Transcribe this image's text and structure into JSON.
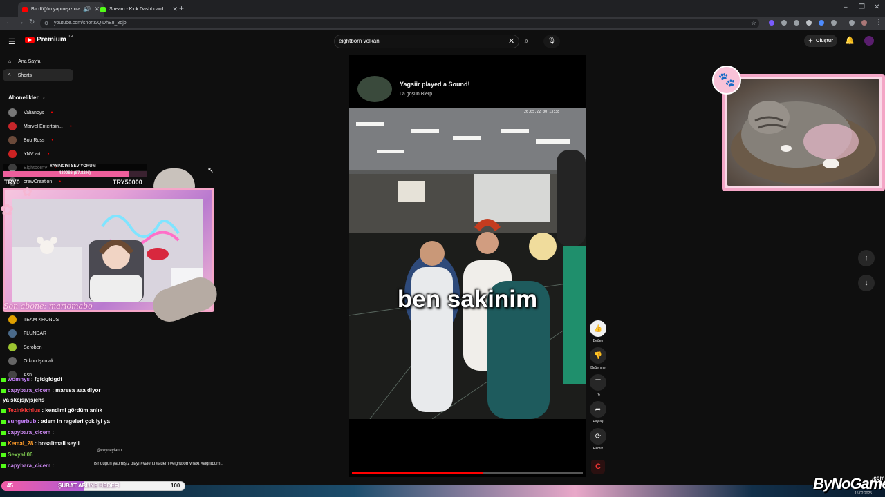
{
  "browser": {
    "tabs": [
      {
        "title": "Bir düğün yapmışız olayı #..."
      },
      {
        "title": "Stream - Kick Dashboard"
      }
    ],
    "url": "youtube.com/shorts/QiDhE8_3qjo"
  },
  "youtube": {
    "logo": "Premium",
    "logo_sup": "TR",
    "search_value": "eightborn volkan",
    "create_label": "Oluştur",
    "nav": [
      {
        "label": "Ana Sayfa",
        "icon": "home-icon"
      },
      {
        "label": "Shorts",
        "icon": "shorts-icon"
      }
    ],
    "subscriptions_label": "Abonelikler",
    "subscriptions": [
      {
        "name": "Valiancys",
        "color": "#777777"
      },
      {
        "name": "Marvel Entertain...",
        "color": "#c7262a"
      },
      {
        "name": "Bob Ross",
        "color": "#6b4a3a"
      },
      {
        "name": "YNV art",
        "color": "#cc2222"
      },
      {
        "name": "EightbornV",
        "color": "#888888"
      },
      {
        "name": "crewCreation",
        "color": "#555555"
      }
    ],
    "subscriptions_lower": [
      {
        "name": "TEAM KHONUS",
        "color": "#e0a000"
      },
      {
        "name": "FLUNDAR",
        "color": "#4a6a8a"
      },
      {
        "name": "Seroben",
        "color": "#9cc431"
      },
      {
        "name": "Orkun Işıtmak",
        "color": "#666666"
      },
      {
        "name": "Asn",
        "color": "#444444"
      }
    ],
    "short": {
      "sound_title": "Yagsiir played a Sound!",
      "sound_subtitle": "La goşun Blerp",
      "caption": "ben sakinim",
      "timestamp": "26.05.22 00:13:38",
      "description": "Bir düğün yapmışız olayı #valenti #adem #eightbornvnext #eightborn...",
      "channel": "@ceyceylann",
      "progress": 0.57,
      "actions": [
        {
          "label": "Beğen",
          "icon": "thumb-up-icon",
          "glyph": "👍"
        },
        {
          "label": "Beğenme",
          "icon": "thumb-down-icon",
          "glyph": "👎"
        },
        {
          "label": "76",
          "icon": "comment-icon",
          "glyph": "☰"
        },
        {
          "label": "Paylaş",
          "icon": "share-icon",
          "glyph": "➦"
        },
        {
          "label": "Remix",
          "icon": "remix-icon",
          "glyph": "⟳"
        }
      ]
    }
  },
  "overlay": {
    "donation_title": "YAYINCIYI SEVİYORUM",
    "donation_progress_text": "439086 (87.82%)",
    "donation_progress": 0.8782,
    "donation_min": "TRY0",
    "donation_max": "TRY50000",
    "last_sub": "Son abone: mariomabo",
    "goal_current": "45",
    "goal_label": "ŞUBAT ABUNE HEDEFİ",
    "goal_target": "100",
    "goal_progress": 0.45,
    "watermark": "ByNoGame",
    "watermark_suffix": ".com",
    "watermark_date": "15.02.2025"
  },
  "chat": [
    {
      "user": "womnys",
      "color": "#c882ff",
      "text": ": fgfdgfdgdf"
    },
    {
      "user": "capybara_cicem",
      "color": "#d08cf7",
      "text": ": maresa aaa diyor"
    },
    {
      "user": "",
      "color": "#ffffff",
      "text": "ya skcjsjvjsjehs"
    },
    {
      "user": "Tezinkichius",
      "color": "#ff3a3a",
      "text": ": kendimi gördüm anlık"
    },
    {
      "user": "sungerbub",
      "color": "#c882ff",
      "text": ": adem in rageleri çok iyi ya"
    },
    {
      "user": "capybara_cicem",
      "color": "#d08cf7",
      "text": ":"
    },
    {
      "user": "Kemal_28",
      "color": "#ff9d2a",
      "text": ": bosaltmali seyli"
    },
    {
      "user": "Sexyall06",
      "color": "#7ec850",
      "text": ""
    },
    {
      "user": "capybara_cicem",
      "color": "#d08cf7",
      "text": ":"
    }
  ],
  "colors": {
    "yt_red": "#ff0000",
    "overlay_pink": "#f5a5c8",
    "chat_purple": "#c882ff"
  }
}
